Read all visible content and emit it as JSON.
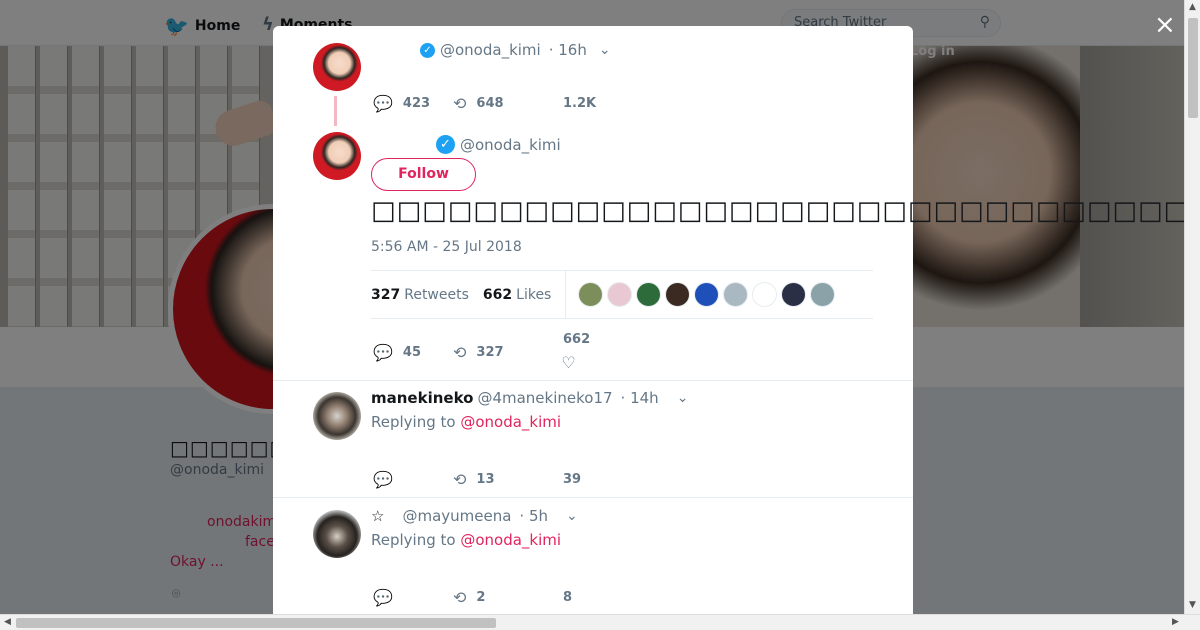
{
  "nav": {
    "home_label": "Home",
    "moments_label": "Moments",
    "search_placeholder": "Search Twitter",
    "login_label": "Log in"
  },
  "profile": {
    "name": "□□□□□□□□□□",
    "handle": "@onoda_kimi",
    "bio_line1": "onodakim",
    "bio_line2": "face",
    "bio_line3": "Okay       ..."
  },
  "modal": {
    "close_label": "×",
    "parent_tweet": {
      "handle": "@onoda_kimi",
      "time": "· 16h",
      "replies": "423",
      "retweets": "648",
      "likes": "1.2K"
    },
    "main_tweet": {
      "handle": "@onoda_kimi",
      "follow_label": "Follow",
      "text": "□□□□□□□□□□□□□□□□□□□□□□□□□□□□□□□□□□□□□□□□□□□□□□□□□□□□□□□□□",
      "timestamp": "5:56 AM - 25 Jul 2018",
      "retweet_count": "327",
      "retweet_label": "Retweets",
      "like_count": "662",
      "like_label": "Likes",
      "replies": "45",
      "retweets": "327",
      "likes": "662"
    },
    "replies": [
      {
        "name": "manekineko",
        "handle": "@4manekineko17",
        "time": "· 14h",
        "replying_prefix": "Replying to",
        "replying_to": "@onoda_kimi",
        "replies": "",
        "retweets": "13",
        "likes": "39"
      },
      {
        "name": "☆",
        "handle": "@mayumeena",
        "time": "· 5h",
        "replying_prefix": "Replying to",
        "replying_to": "@onoda_kimi",
        "replies": "",
        "retweets": "2",
        "likes": "8"
      }
    ]
  },
  "colors": {
    "twitter_blue": "#1da1f2",
    "accent_pink": "#e0245e",
    "muted_text": "#657786"
  },
  "liker_colors": [
    "#7c8f5a",
    "#e8c9d3",
    "#2e6b3a",
    "#3b2a22",
    "#1f4fb8",
    "#aab8c2",
    "#ffffff",
    "#2b2f45",
    "#8aa2a8"
  ]
}
